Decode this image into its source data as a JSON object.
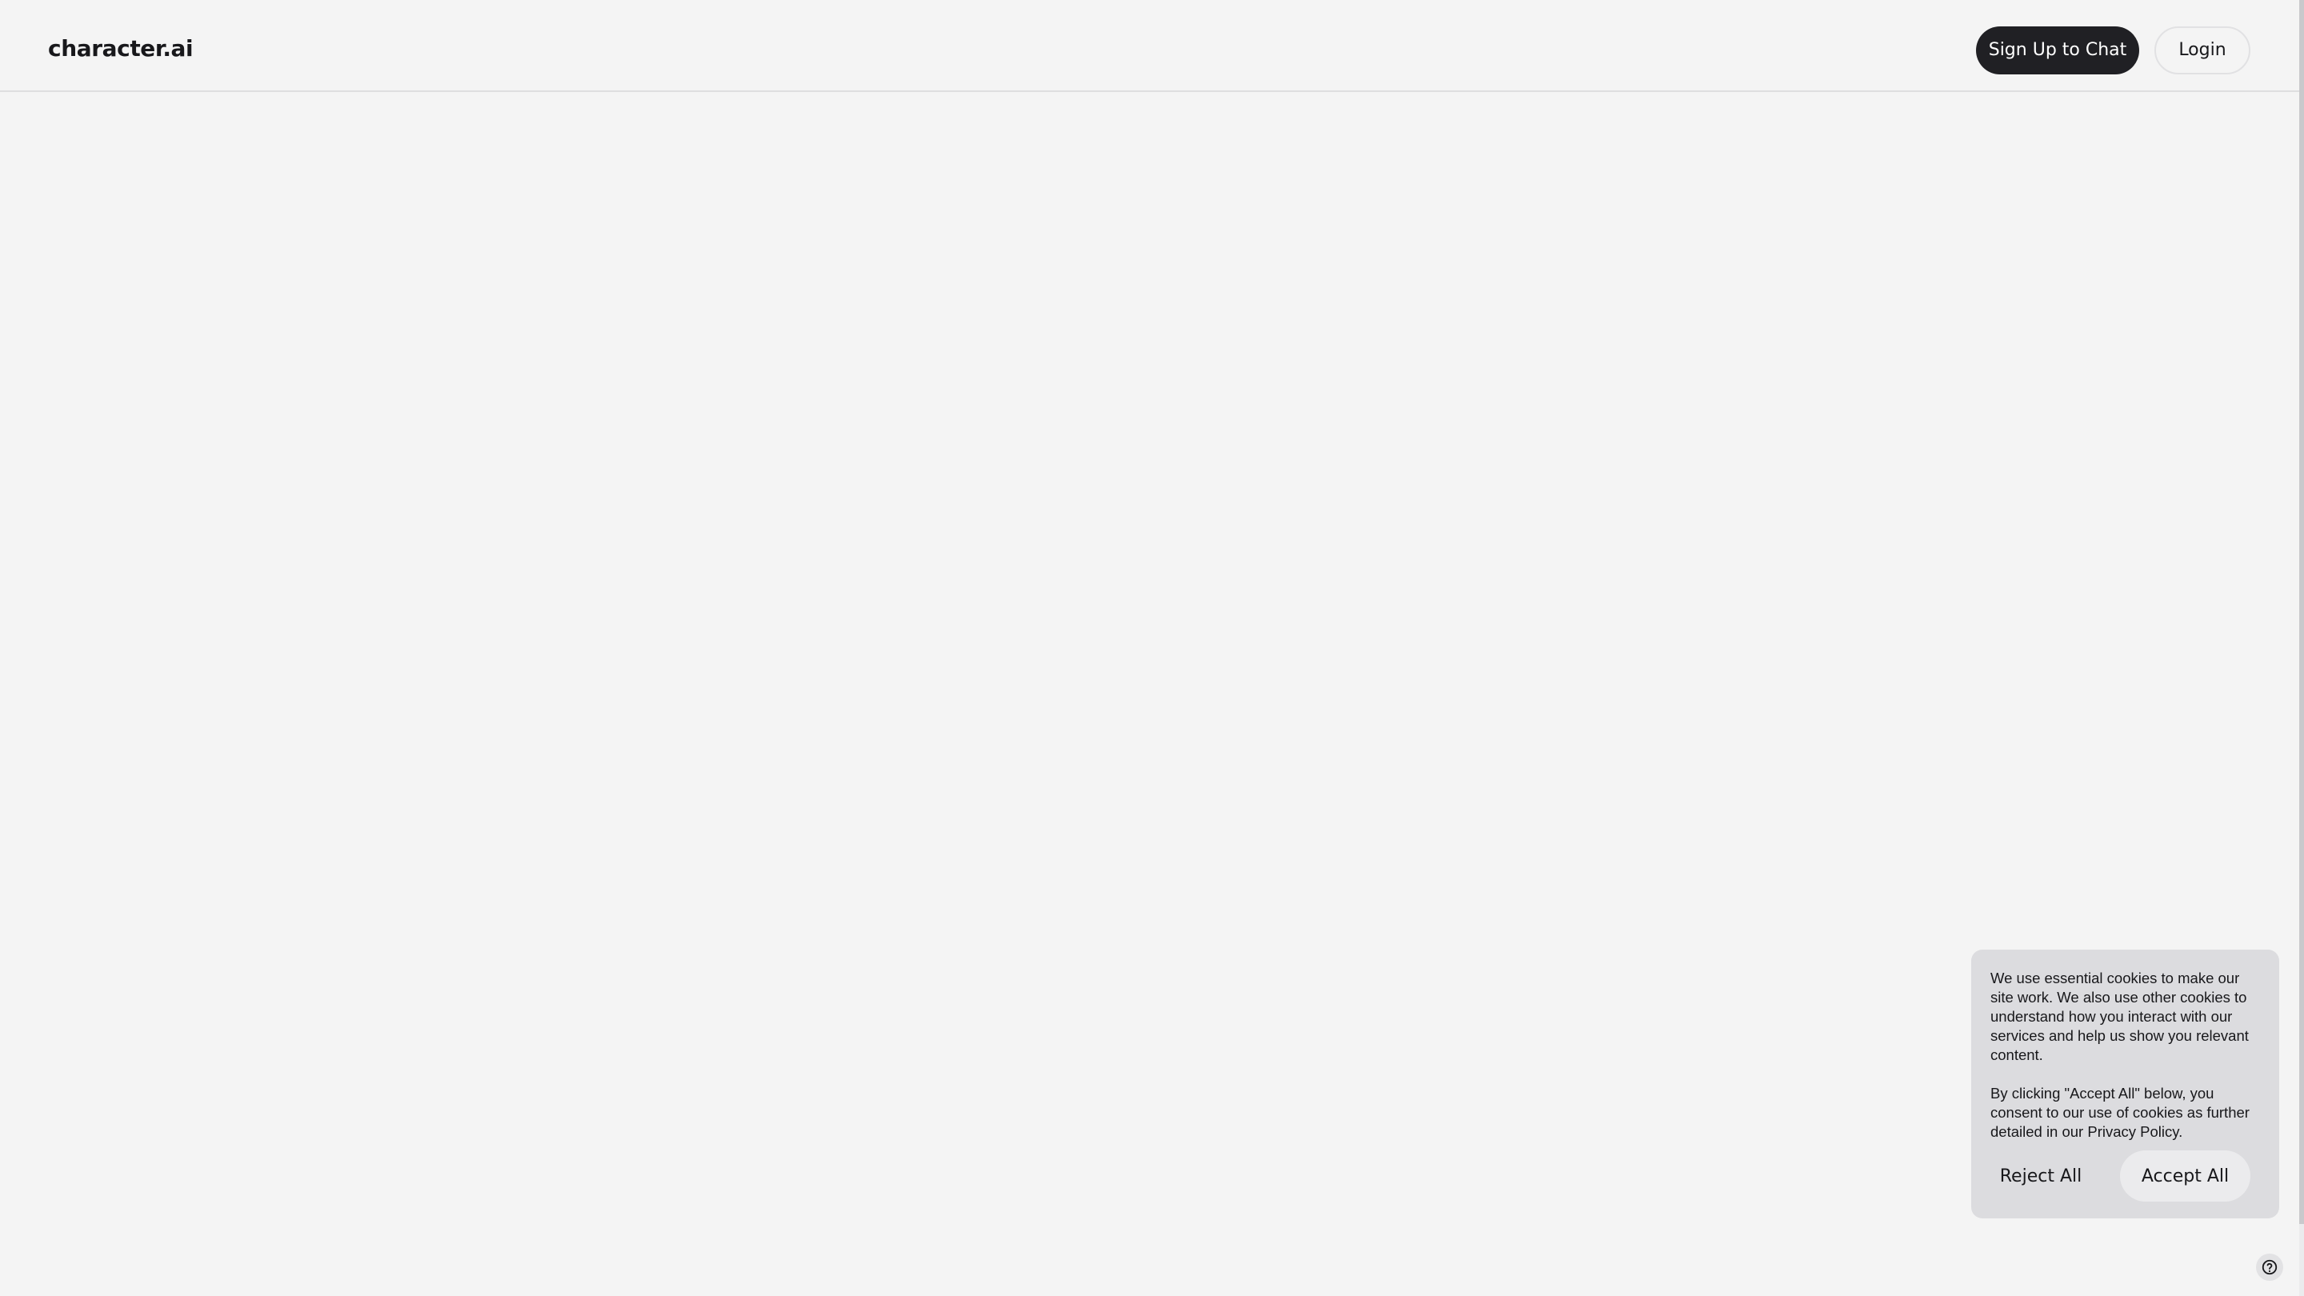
{
  "header": {
    "logo_text": "character.ai",
    "signup_label": "Sign Up to Chat",
    "login_label": "Login"
  },
  "cookie_banner": {
    "paragraph_1": "We use essential cookies to make our site work. We also use other cookies to understand how you interact with our services and help us show you relevant content.",
    "paragraph_2": "By clicking \"Accept All\" below, you consent to our use of cookies as further detailed in our Privacy Policy.",
    "reject_label": "Reject All",
    "accept_label": "Accept All"
  },
  "help": {
    "icon": "help-circle-icon"
  },
  "colors": {
    "background": "#f4f4f4",
    "primary_button": "#202024",
    "cookie_panel": "#dcdcdf"
  }
}
